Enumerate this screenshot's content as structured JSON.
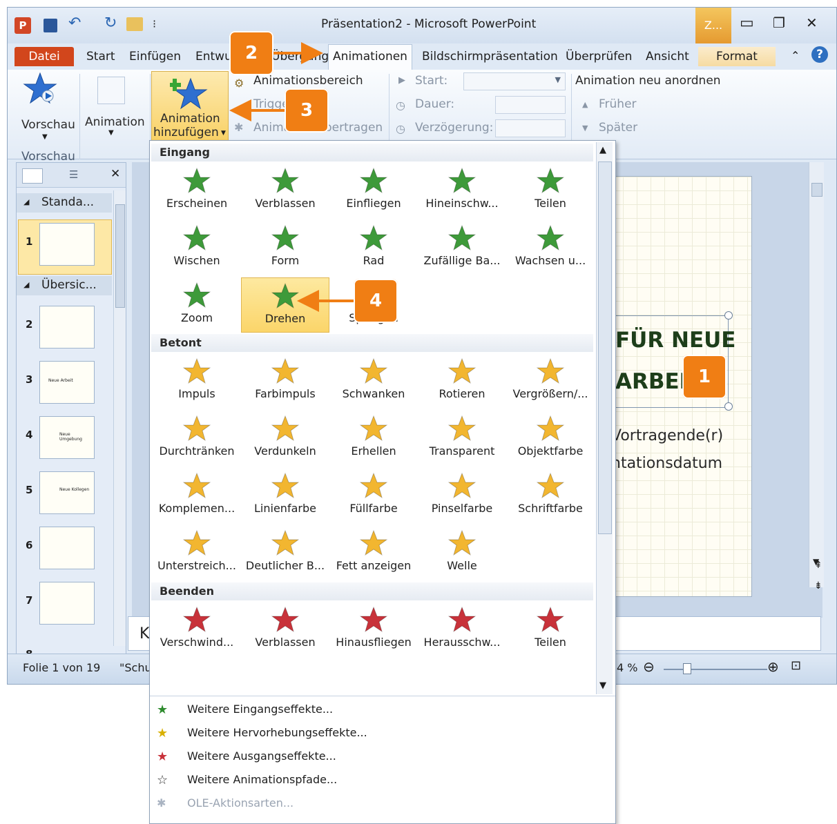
{
  "window": {
    "title": "Präsentation2 - Microsoft PowerPoint",
    "context_tab": "Z...",
    "context_label": "Format"
  },
  "tabs": [
    "Datei",
    "Start",
    "Einfügen",
    "Entwu",
    "Übergänge",
    "Animationen",
    "Bildschirmpräsentation",
    "Überprüfen",
    "Ansicht"
  ],
  "ribbon": {
    "vorschau": "Vorschau",
    "animation": "Animation",
    "add_animation_1": "Animation",
    "add_animation_2": "hinzufügen",
    "group_vorschau": "Vorschau",
    "animationsbereich": "Animationsbereich",
    "trigger": "Trigger",
    "animation_uebertragen": "Animation übertragen",
    "start": "Start:",
    "dauer": "Dauer:",
    "verzoegerung": "Verzögerung:",
    "neu_anordnen": "Animation neu anordnen",
    "frueher": "Früher",
    "spaeter": "Später"
  },
  "panel": {
    "section1": "Standa...",
    "section2": "Übersic...",
    "slide_numbers": [
      "1",
      "2",
      "3",
      "4",
      "5",
      "6",
      "7",
      "8"
    ],
    "thumb_texts": [
      "",
      "",
      "Neue Arbeit",
      "Neue Umgebung",
      "Neue Kollegen",
      "",
      "",
      ""
    ]
  },
  "slide": {
    "title_line1": "FÜR NEUE",
    "title_line2": "ARBEI",
    "sub1": "Vortragende(r)",
    "sub2": "ntationsdatum",
    "notes_text": "K"
  },
  "status": {
    "slide": "Folie 1 von 19",
    "theme": "\"Schu",
    "zoom": "4 %"
  },
  "callouts": [
    "1",
    "2",
    "3",
    "4"
  ],
  "gallery": {
    "sections": [
      "Eingang",
      "Betont",
      "Beenden"
    ],
    "eingang": [
      "Erscheinen",
      "Verblassen",
      "Einfliegen",
      "Hineinschw...",
      "Teilen",
      "Wischen",
      "Form",
      "Rad",
      "Zufällige Ba...",
      "Wachsen u...",
      "Zoom",
      "Drehen",
      "Springen"
    ],
    "betont": [
      "Impuls",
      "Farbimpuls",
      "Schwanken",
      "Rotieren",
      "Vergrößern/...",
      "Durchtränken",
      "Verdunkeln",
      "Erhellen",
      "Transparent",
      "Objektfarbe",
      "Komplemen...",
      "Linienfarbe",
      "Füllfarbe",
      "Pinselfarbe",
      "Schriftfarbe",
      "Unterstreich...",
      "Deutlicher B...",
      "Fett anzeigen",
      "Welle"
    ],
    "beenden": [
      "Verschwind...",
      "Verblassen",
      "Hinausfliegen",
      "Herausschw...",
      "Teilen"
    ],
    "more": [
      "Weitere Eingangseffekte...",
      "Weitere Hervorhebungseffekte...",
      "Weitere Ausgangseffekte...",
      "Weitere Animationspfade...",
      "OLE-Aktionsarten..."
    ]
  },
  "colors": {
    "accent": "#f07e14",
    "datei": "#d2461c",
    "entrance": "#3e9a3a",
    "emphasis": "#f2b630",
    "exit": "#c8323a"
  }
}
